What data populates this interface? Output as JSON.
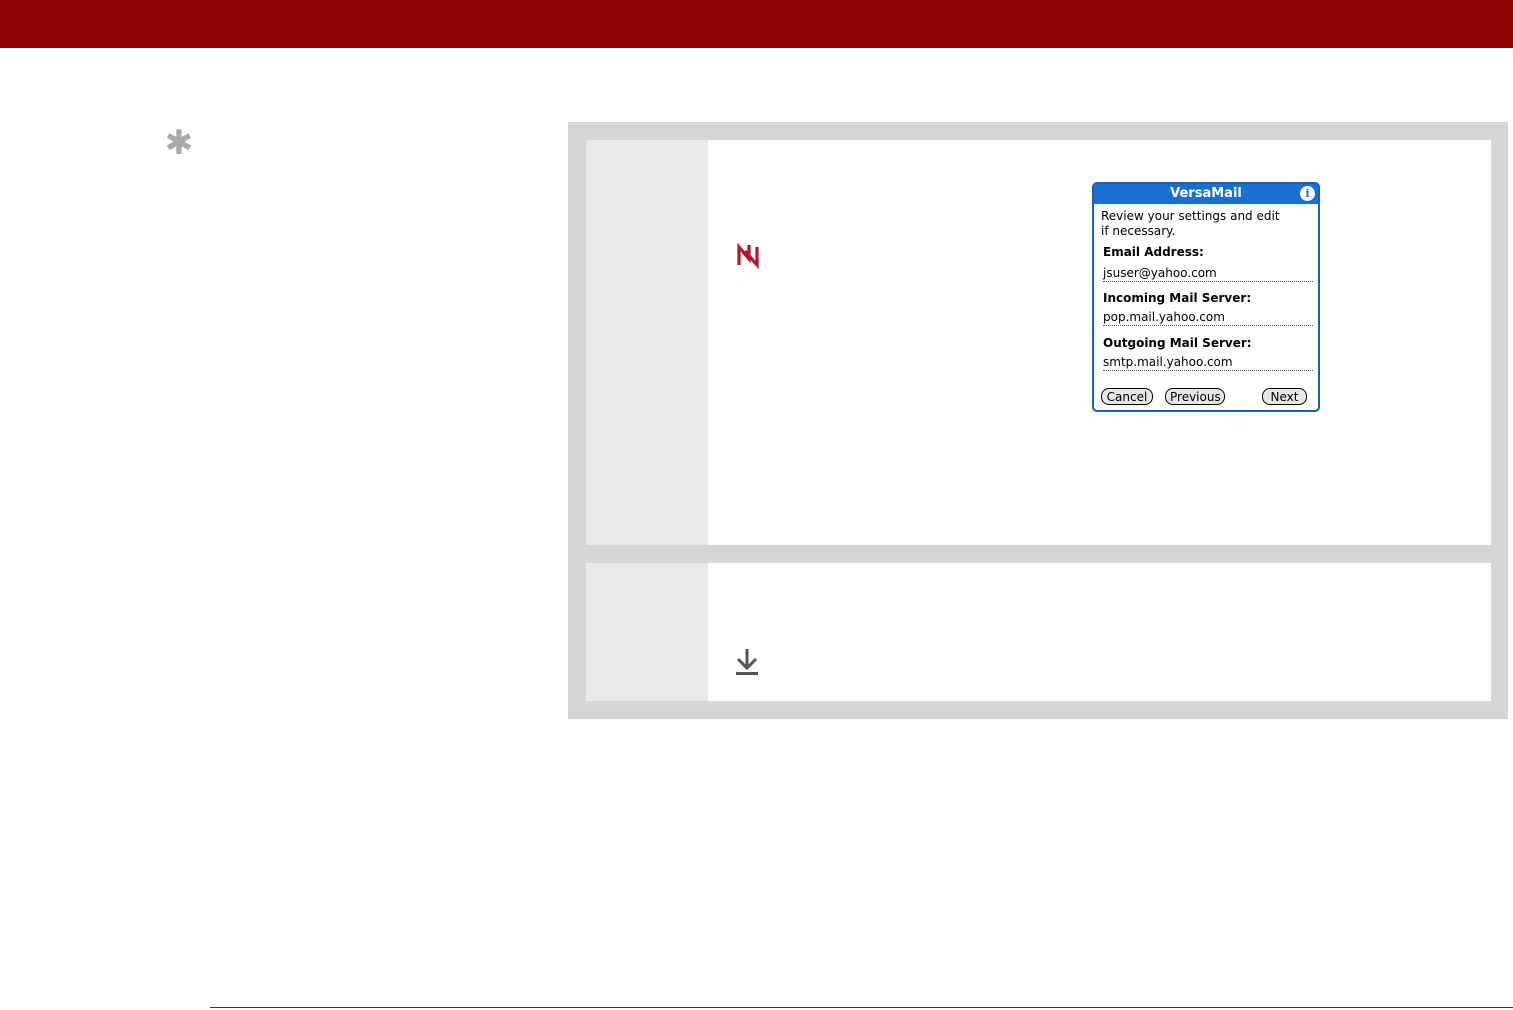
{
  "dialog": {
    "title": "VersaMail",
    "info_glyph": "i",
    "intro": "Review your settings and edit\nif necessary.",
    "fields": [
      {
        "label": "Email Address:",
        "value": "jsuser@yahoo.com"
      },
      {
        "label": "Incoming Mail Server:",
        "value": "pop.mail.yahoo.com"
      },
      {
        "label": "Outgoing Mail Server:",
        "value": "smtp.mail.yahoo.com"
      }
    ],
    "buttons": {
      "cancel": "Cancel",
      "previous": "Previous",
      "next": "Next"
    }
  },
  "icons": {
    "tip": "asterisk-icon",
    "step1": "important-icon",
    "step2": "done-download-icon"
  },
  "colors": {
    "topbar": "#8b0000",
    "dialog_accent": "#1a6fd0",
    "important_icon": "#b0182a"
  }
}
